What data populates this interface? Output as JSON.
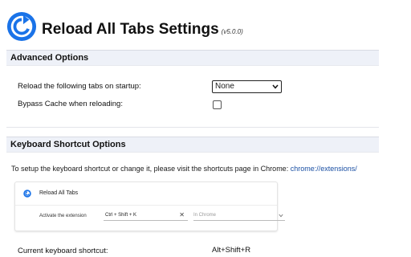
{
  "header": {
    "title": "Reload All Tabs Settings",
    "version": "(v5.0.0)",
    "logo_icon": "reload-circle-icon",
    "brand_color": "#1a73e8"
  },
  "advanced": {
    "heading": "Advanced Options",
    "reload_label": "Reload the following tabs on startup:",
    "reload_value": "None",
    "bypass_label": "Bypass Cache when reloading:",
    "bypass_checked": false
  },
  "keyboard": {
    "heading": "Keyboard Shortcut Options",
    "info_text": "To setup the keyboard shortcut or change it, please visit the shortcuts page in Chrome: ",
    "info_link": "chrome://extensions/",
    "card": {
      "title": "Reload All Tabs",
      "action_label": "Activate the extension",
      "shortcut_value": "Ctrl + Shift + K",
      "scope_value": "In Chrome"
    },
    "current_label": "Current keyboard shortcut:",
    "current_value": "Alt+Shift+R"
  },
  "colors": {
    "section_bg": "#eef1f8",
    "link": "#1a4fa3"
  }
}
